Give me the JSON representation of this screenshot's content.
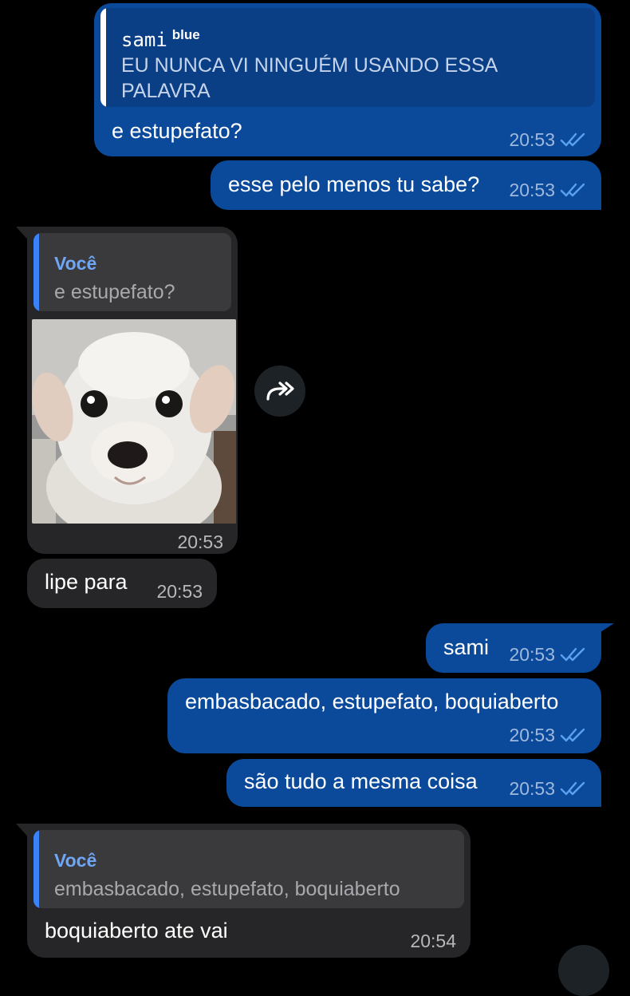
{
  "messages": {
    "m1": {
      "reply": {
        "name": "sami",
        "name_suffix": "blue",
        "text_line1": "EU NUNCA VI NINGUÉM USANDO ESSA",
        "text_line2": "PALAVRA"
      },
      "text": "e estupefato?",
      "time": "20:53"
    },
    "m2": {
      "text": "esse pelo menos tu sabe?",
      "time": "20:53"
    },
    "m3": {
      "reply": {
        "name": "Você",
        "text": "e estupefato?"
      },
      "image_description": "white puppy sticker",
      "time": "20:53"
    },
    "m4": {
      "text": "lipe para",
      "time": "20:53"
    },
    "m5": {
      "text": "sami",
      "time": "20:53"
    },
    "m6": {
      "text": "embasbacado, estupefato, boquiaberto",
      "time": "20:53"
    },
    "m7": {
      "text": "são tudo a mesma coisa",
      "time": "20:53"
    },
    "m8": {
      "reply": {
        "name": "Você",
        "text": "embasbacado, estupefato, boquiaberto"
      },
      "text": "boquiaberto ate vai",
      "time": "20:54"
    }
  },
  "colors": {
    "outgoing_bubble": "#0b4a9a",
    "incoming_bubble": "#262628",
    "read_ticks": "#5aa2f0",
    "reply_accent_in": "#3a82f7",
    "background": "#000000"
  },
  "icons": {
    "forward": "share-forward-icon",
    "read": "double-check-icon"
  }
}
